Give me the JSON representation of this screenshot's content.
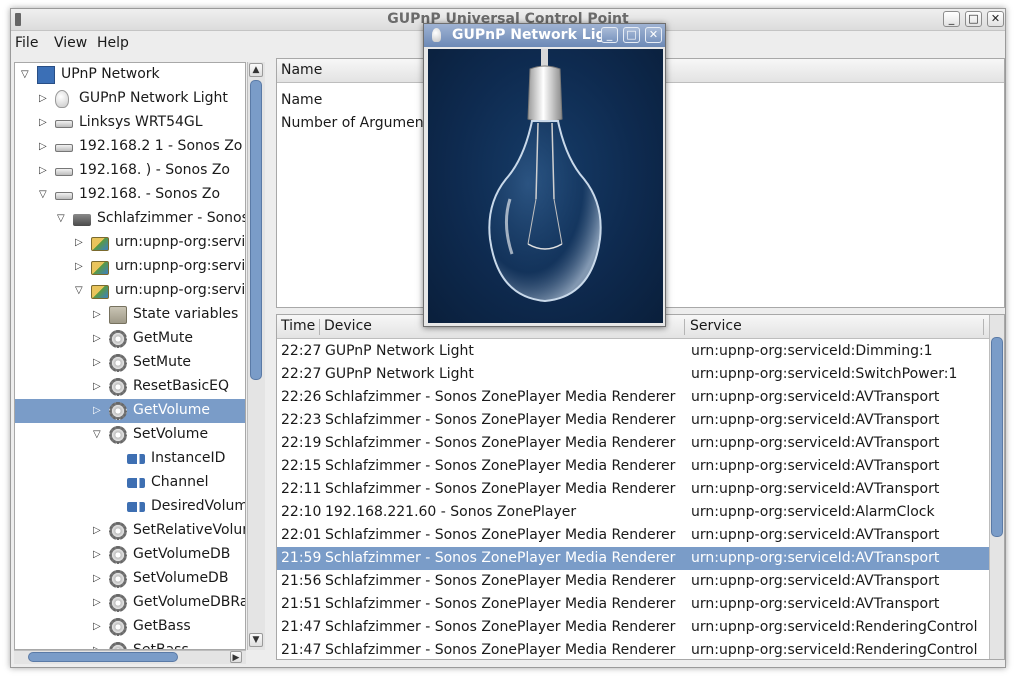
{
  "window": {
    "title": "GUPnP Universal Control Point",
    "controls": {
      "minimize": "_",
      "maximize": "□",
      "close": "✕"
    }
  },
  "menu": {
    "file": "File",
    "view": "View",
    "help": "Help"
  },
  "tree": {
    "items": [
      {
        "label": "UPnP Network",
        "icon": "network-icon",
        "depth": 0,
        "expander": "open"
      },
      {
        "label": "GUPnP Network Light",
        "icon": "lightbulb-icon",
        "depth": 1,
        "expander": "closed"
      },
      {
        "label": "Linksys WRT54GL",
        "icon": "router-icon",
        "depth": 1,
        "expander": "closed"
      },
      {
        "label": "192.168.2   1 - Sonos Zo",
        "icon": "router-icon",
        "depth": 1,
        "expander": "closed"
      },
      {
        "label": "192.168.    ) - Sonos Zo",
        "icon": "router-icon",
        "depth": 1,
        "expander": "closed"
      },
      {
        "label": "192.168.     - Sonos Zo",
        "icon": "router-icon",
        "depth": 1,
        "expander": "open"
      },
      {
        "label": "Schlafzimmer - Sonos Z",
        "icon": "device-icon",
        "depth": 2,
        "expander": "open"
      },
      {
        "label": "urn:upnp-org:service",
        "icon": "service-icon",
        "depth": 3,
        "expander": "closed"
      },
      {
        "label": "urn:upnp-org:service",
        "icon": "service-icon",
        "depth": 3,
        "expander": "closed"
      },
      {
        "label": "urn:upnp-org:service",
        "icon": "service-icon",
        "depth": 3,
        "expander": "open"
      },
      {
        "label": "State variables",
        "icon": "folder-icon",
        "depth": 4,
        "expander": "closed"
      },
      {
        "label": "GetMute",
        "icon": "gear-icon",
        "depth": 4,
        "expander": "closed"
      },
      {
        "label": "SetMute",
        "icon": "gear-icon",
        "depth": 4,
        "expander": "closed"
      },
      {
        "label": "ResetBasicEQ",
        "icon": "gear-icon",
        "depth": 4,
        "expander": "closed"
      },
      {
        "label": "GetVolume",
        "icon": "gear-icon",
        "depth": 4,
        "expander": "closed",
        "selected": true
      },
      {
        "label": "SetVolume",
        "icon": "gear-icon",
        "depth": 4,
        "expander": "open"
      },
      {
        "label": "InstanceID",
        "icon": "argument-in-icon",
        "depth": 5,
        "expander": "none"
      },
      {
        "label": "Channel",
        "icon": "argument-in-icon",
        "depth": 5,
        "expander": "none"
      },
      {
        "label": "DesiredVolume",
        "icon": "argument-in-icon",
        "depth": 5,
        "expander": "none"
      },
      {
        "label": "SetRelativeVolum",
        "icon": "gear-icon",
        "depth": 4,
        "expander": "closed"
      },
      {
        "label": "GetVolumeDB",
        "icon": "gear-icon",
        "depth": 4,
        "expander": "closed"
      },
      {
        "label": "SetVolumeDB",
        "icon": "gear-icon",
        "depth": 4,
        "expander": "closed"
      },
      {
        "label": "GetVolumeDBRar",
        "icon": "gear-icon",
        "depth": 4,
        "expander": "closed"
      },
      {
        "label": "GetBass",
        "icon": "gear-icon",
        "depth": 4,
        "expander": "closed"
      },
      {
        "label": "SetBass",
        "icon": "gear-icon",
        "depth": 4,
        "expander": "closed"
      }
    ]
  },
  "details": {
    "column_header": "Name",
    "rows": [
      "Name",
      "Number of Arguments"
    ]
  },
  "log": {
    "columns": {
      "time": "Time",
      "device": "Device",
      "service": "Service",
      "extra": "S"
    },
    "rows": [
      {
        "time": "22:27",
        "device": "GUPnP Network Light",
        "service": "urn:upnp-org:serviceId:Dimming:1"
      },
      {
        "time": "22:27",
        "device": "GUPnP Network Light",
        "service": "urn:upnp-org:serviceId:SwitchPower:1"
      },
      {
        "time": "22:26",
        "device": "Schlafzimmer - Sonos ZonePlayer Media Renderer",
        "service": "urn:upnp-org:serviceId:AVTransport"
      },
      {
        "time": "22:23",
        "device": "Schlafzimmer - Sonos ZonePlayer Media Renderer",
        "service": "urn:upnp-org:serviceId:AVTransport"
      },
      {
        "time": "22:19",
        "device": "Schlafzimmer - Sonos ZonePlayer Media Renderer",
        "service": "urn:upnp-org:serviceId:AVTransport"
      },
      {
        "time": "22:15",
        "device": "Schlafzimmer - Sonos ZonePlayer Media Renderer",
        "service": "urn:upnp-org:serviceId:AVTransport"
      },
      {
        "time": "22:11",
        "device": "Schlafzimmer - Sonos ZonePlayer Media Renderer",
        "service": "urn:upnp-org:serviceId:AVTransport"
      },
      {
        "time": "22:10",
        "device": "192.168.221.60 - Sonos ZonePlayer",
        "service": "urn:upnp-org:serviceId:AlarmClock"
      },
      {
        "time": "22:01",
        "device": "Schlafzimmer - Sonos ZonePlayer Media Renderer",
        "service": "urn:upnp-org:serviceId:AVTransport"
      },
      {
        "time": "21:59",
        "device": "Schlafzimmer - Sonos ZonePlayer Media Renderer",
        "service": "urn:upnp-org:serviceId:AVTransport",
        "selected": true
      },
      {
        "time": "21:56",
        "device": "Schlafzimmer - Sonos ZonePlayer Media Renderer",
        "service": "urn:upnp-org:serviceId:AVTransport"
      },
      {
        "time": "21:51",
        "device": "Schlafzimmer - Sonos ZonePlayer Media Renderer",
        "service": "urn:upnp-org:serviceId:AVTransport"
      },
      {
        "time": "21:47",
        "device": "Schlafzimmer - Sonos ZonePlayer Media Renderer",
        "service": "urn:upnp-org:serviceId:RenderingControl"
      },
      {
        "time": "21:47",
        "device": "Schlafzimmer - Sonos ZonePlayer Media Renderer",
        "service": "urn:upnp-org:serviceId:RenderingControl"
      }
    ]
  },
  "light_window": {
    "title": "GUPnP Network Light",
    "controls": {
      "minimize": "_",
      "maximize": "□",
      "close": "✕"
    },
    "state": "off"
  },
  "colors": {
    "selection": "#7a9cc8",
    "light_background": "#0e2a4f"
  }
}
